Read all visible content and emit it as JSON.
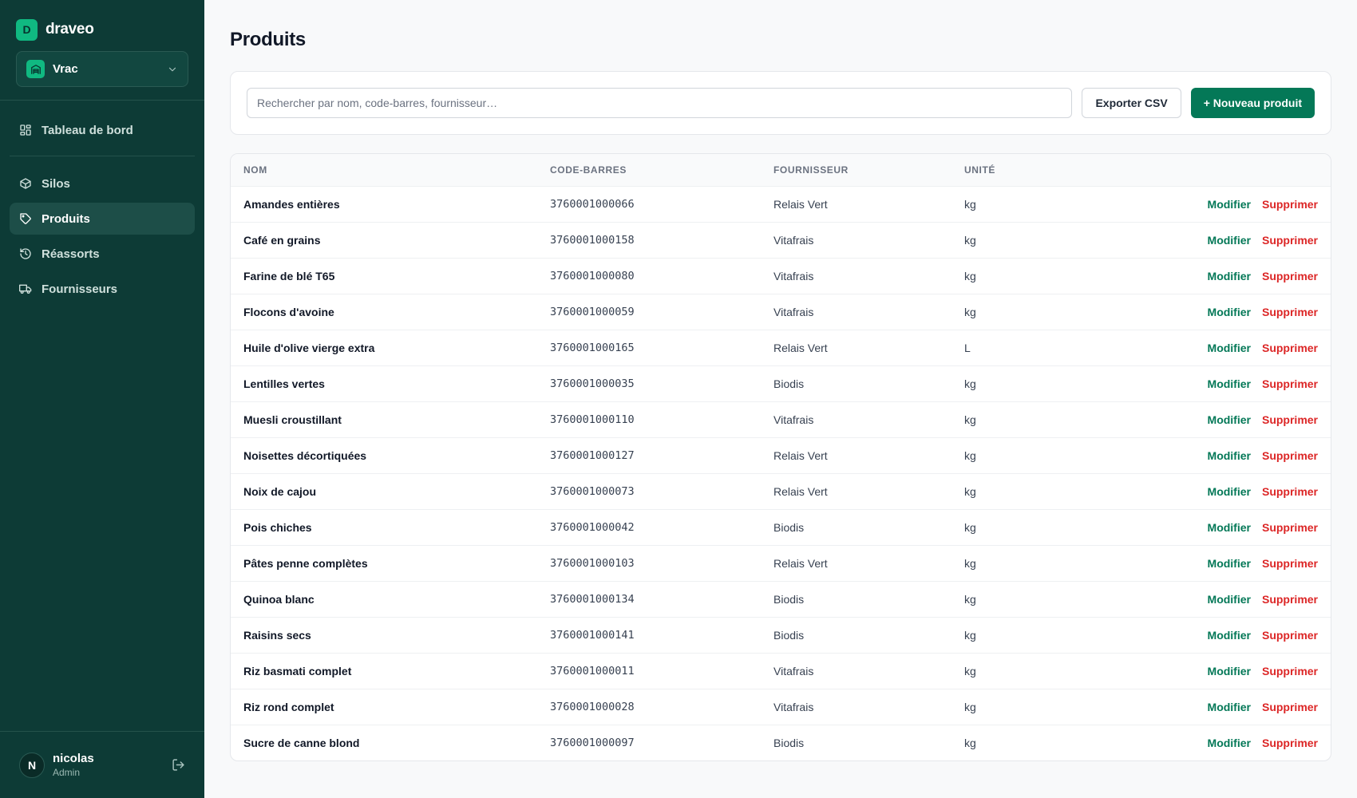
{
  "brand": {
    "logo_letter": "D",
    "name": "draveo"
  },
  "workspace": {
    "name": "Vrac"
  },
  "nav": [
    {
      "label": "Tableau de bord",
      "icon": "dashboard-icon",
      "active": false
    },
    {
      "label": "Silos",
      "icon": "box-icon",
      "active": false
    },
    {
      "label": "Produits",
      "icon": "tag-icon",
      "active": true
    },
    {
      "label": "Réassorts",
      "icon": "history-icon",
      "active": false
    },
    {
      "label": "Fournisseurs",
      "icon": "truck-icon",
      "active": false
    }
  ],
  "user": {
    "initial": "N",
    "name": "nicolas",
    "role": "Admin"
  },
  "page": {
    "title": "Produits"
  },
  "toolbar": {
    "search_placeholder": "Rechercher par nom, code-barres, fournisseur…",
    "search_value": "",
    "export_label": "Exporter CSV",
    "new_label": "+ Nouveau produit"
  },
  "table": {
    "columns": [
      "NOM",
      "CODE-BARRES",
      "FOURNISSEUR",
      "UNITÉ",
      ""
    ],
    "edit_label": "Modifier",
    "delete_label": "Supprimer",
    "rows": [
      {
        "name": "Amandes entières",
        "code": "3760001000066",
        "supplier": "Relais Vert",
        "unit": "kg"
      },
      {
        "name": "Café en grains",
        "code": "3760001000158",
        "supplier": "Vitafrais",
        "unit": "kg"
      },
      {
        "name": "Farine de blé T65",
        "code": "3760001000080",
        "supplier": "Vitafrais",
        "unit": "kg"
      },
      {
        "name": "Flocons d'avoine",
        "code": "3760001000059",
        "supplier": "Vitafrais",
        "unit": "kg"
      },
      {
        "name": "Huile d'olive vierge extra",
        "code": "3760001000165",
        "supplier": "Relais Vert",
        "unit": "L"
      },
      {
        "name": "Lentilles vertes",
        "code": "3760001000035",
        "supplier": "Biodis",
        "unit": "kg"
      },
      {
        "name": "Muesli croustillant",
        "code": "3760001000110",
        "supplier": "Vitafrais",
        "unit": "kg"
      },
      {
        "name": "Noisettes décortiquées",
        "code": "3760001000127",
        "supplier": "Relais Vert",
        "unit": "kg"
      },
      {
        "name": "Noix de cajou",
        "code": "3760001000073",
        "supplier": "Relais Vert",
        "unit": "kg"
      },
      {
        "name": "Pois chiches",
        "code": "3760001000042",
        "supplier": "Biodis",
        "unit": "kg"
      },
      {
        "name": "Pâtes penne complètes",
        "code": "3760001000103",
        "supplier": "Relais Vert",
        "unit": "kg"
      },
      {
        "name": "Quinoa blanc",
        "code": "3760001000134",
        "supplier": "Biodis",
        "unit": "kg"
      },
      {
        "name": "Raisins secs",
        "code": "3760001000141",
        "supplier": "Biodis",
        "unit": "kg"
      },
      {
        "name": "Riz basmati complet",
        "code": "3760001000011",
        "supplier": "Vitafrais",
        "unit": "kg"
      },
      {
        "name": "Riz rond complet",
        "code": "3760001000028",
        "supplier": "Vitafrais",
        "unit": "kg"
      },
      {
        "name": "Sucre de canne blond",
        "code": "3760001000097",
        "supplier": "Biodis",
        "unit": "kg"
      }
    ]
  },
  "colors": {
    "sidebar_bg": "#0d3b36",
    "accent": "#10b981",
    "primary_button": "#047857",
    "edit_link": "#047857",
    "delete_link": "#dc2626"
  }
}
